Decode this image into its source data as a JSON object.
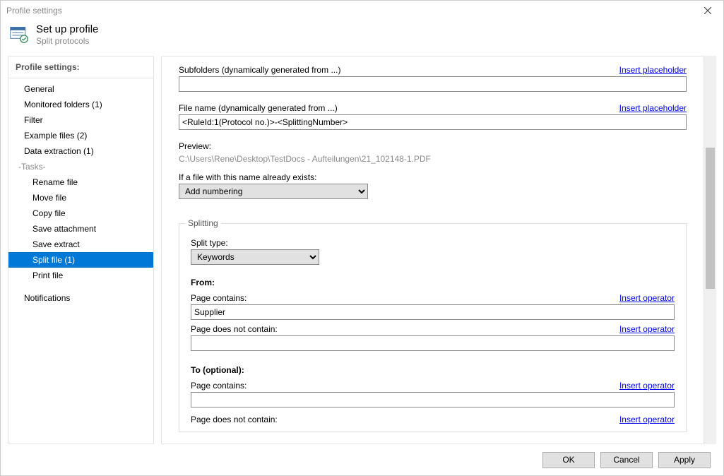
{
  "window": {
    "title": "Profile settings"
  },
  "header": {
    "title": "Set up profile",
    "subtitle": "Split protocols"
  },
  "sidebar": {
    "title": "Profile settings:",
    "items": [
      {
        "label": "General"
      },
      {
        "label": "Monitored folders (1)"
      },
      {
        "label": "Filter"
      },
      {
        "label": "Example files (2)"
      },
      {
        "label": "Data extraction (1)"
      }
    ],
    "tasks_label": "-Tasks-",
    "tasks": [
      {
        "label": "Rename file"
      },
      {
        "label": "Move file"
      },
      {
        "label": "Copy file"
      },
      {
        "label": "Save attachment"
      },
      {
        "label": "Save extract"
      },
      {
        "label": "Split file (1)",
        "selected": true
      },
      {
        "label": "Print file"
      }
    ],
    "footer_item": {
      "label": "Notifications"
    }
  },
  "main": {
    "subfolders": {
      "label": "Subfolders (dynamically generated from ...)",
      "link": "Insert placeholder",
      "value": ""
    },
    "filename": {
      "label": "File name (dynamically generated from ...)",
      "link": "Insert placeholder",
      "value": "<RuleId:1(Protocol no.)>-<SplittingNumber>"
    },
    "preview": {
      "label": "Preview:",
      "path": "C:\\Users\\Rene\\Desktop\\TestDocs - Aufteilungen\\21_102148-1.PDF"
    },
    "exists": {
      "label": "If a file with this name already exists:",
      "value": "Add numbering"
    },
    "splitting": {
      "legend": "Splitting",
      "split_type_label": "Split type:",
      "split_type_value": "Keywords",
      "from_label": "From:",
      "to_label": "To (optional):",
      "page_contains_label": "Page contains:",
      "page_not_contains_label": "Page does not contain:",
      "insert_operator": "Insert operator",
      "from_contains_value": "Supplier",
      "from_not_contains_value": "",
      "to_contains_value": ""
    }
  },
  "footer": {
    "ok": "OK",
    "cancel": "Cancel",
    "apply": "Apply"
  }
}
